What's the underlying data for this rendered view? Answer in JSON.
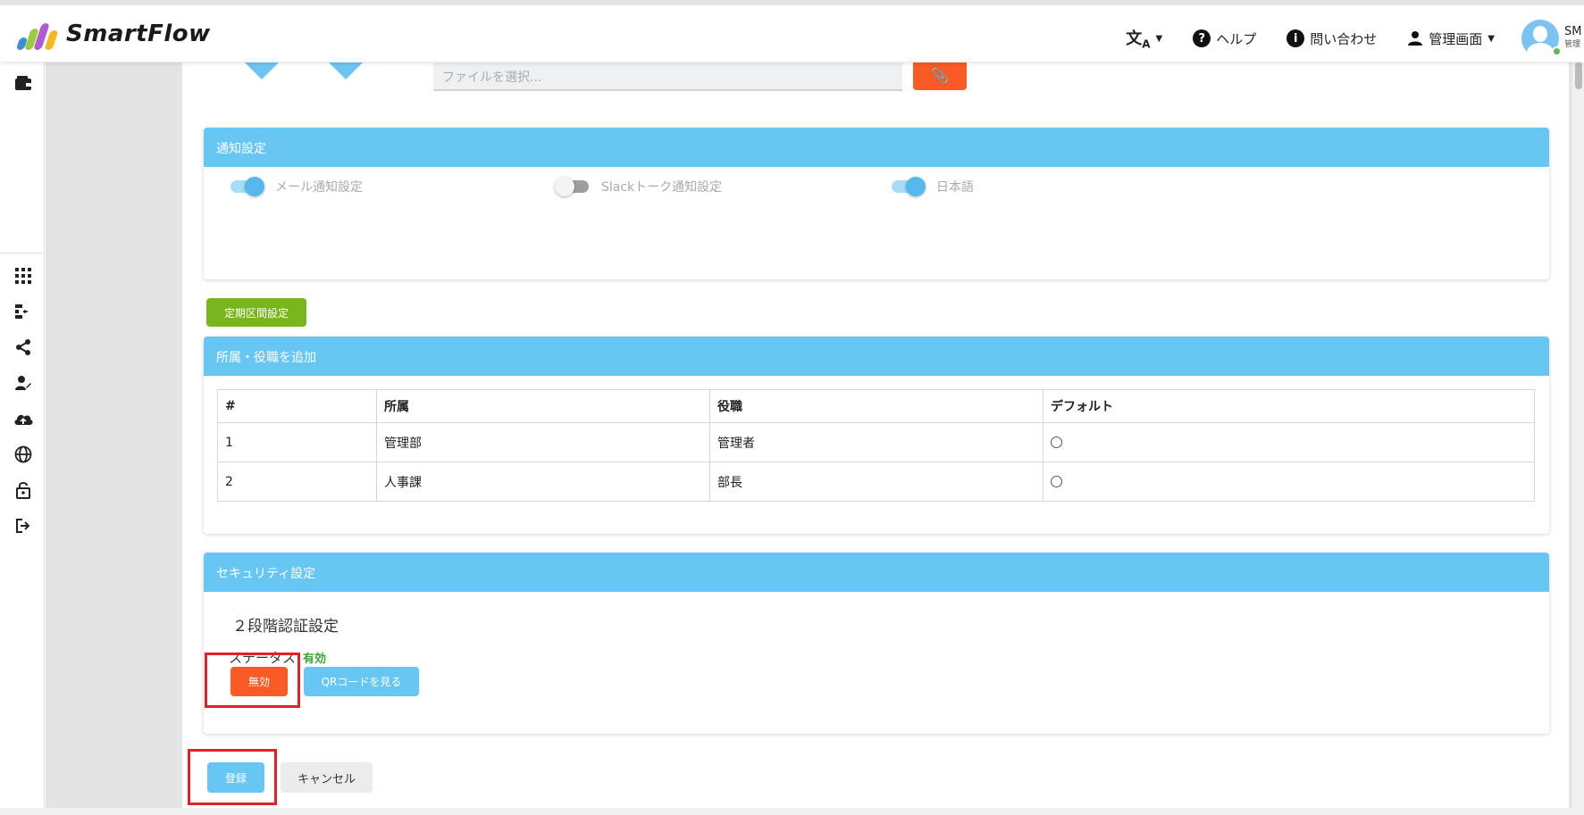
{
  "header": {
    "logo_text": "SmartFlow",
    "nav": {
      "language_label": "",
      "help_label": "ヘルプ",
      "contact_label": "問い合わせ",
      "admin_label": "管理画面"
    },
    "user": {
      "name": "SM",
      "role": "管理"
    }
  },
  "sidebar": {
    "icons": [
      "wallet-icon",
      "apps-grid-icon",
      "workflow-icon",
      "share-icon",
      "user-edit-icon",
      "cloud-upload-icon",
      "globe-icon",
      "lock-icon",
      "logout-icon"
    ]
  },
  "file_section": {
    "placeholder": "ファイルを選択..."
  },
  "notification": {
    "title": "通知設定",
    "toggles": [
      {
        "label": "メール通知設定",
        "on": true
      },
      {
        "label": "Slackトーク通知設定",
        "on": false
      },
      {
        "label": "日本語",
        "on": true
      }
    ]
  },
  "schedule_button": "定期区間設定",
  "affiliation": {
    "title": "所属・役職を追加",
    "columns": [
      "#",
      "所属",
      "役職",
      "デフォルト"
    ],
    "rows": [
      {
        "no": "1",
        "dept": "管理部",
        "position": "管理者"
      },
      {
        "no": "2",
        "dept": "人事課",
        "position": "部長"
      }
    ]
  },
  "security": {
    "title": "セキュリティ設定",
    "two_factor_title": "２段階認証設定",
    "status_label": "ステータス",
    "status_value": "有効",
    "disable_button": "無効",
    "qr_button": "QRコードを見る"
  },
  "footer_buttons": {
    "register": "登録",
    "cancel": "キャンセル"
  },
  "colors": {
    "header_blue": "#67c6f2",
    "orange": "#fa5a25",
    "green": "#79b51c",
    "status_green": "#3aa536",
    "highlight_red": "#e3202a"
  }
}
